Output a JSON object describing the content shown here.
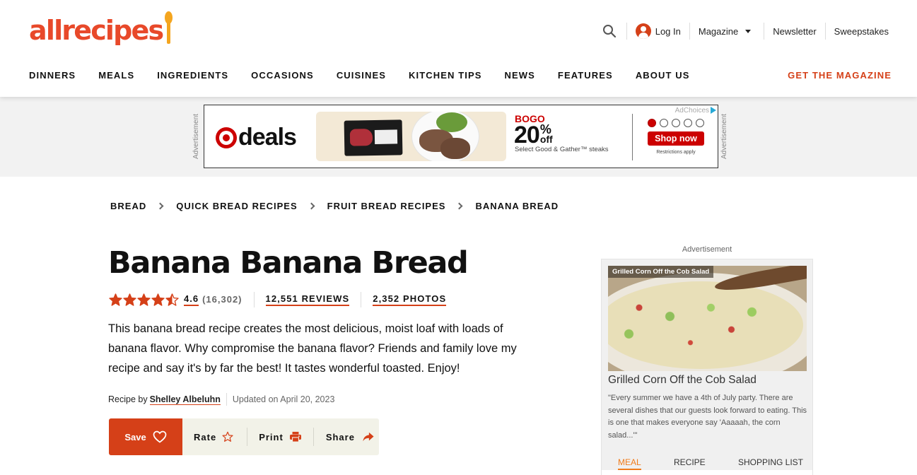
{
  "brand": {
    "logo_text": "allrecipes",
    "accent_color": "#d54018",
    "logo_color": "#e8492a",
    "spoon_color": "#f4a51f"
  },
  "utility_nav": {
    "search_icon": "search-icon",
    "login_label": "Log In",
    "magazine_label": "Magazine",
    "newsletter_label": "Newsletter",
    "sweepstakes_label": "Sweepstakes"
  },
  "main_nav": {
    "items": [
      {
        "label": "DINNERS"
      },
      {
        "label": "MEALS"
      },
      {
        "label": "INGREDIENTS"
      },
      {
        "label": "OCCASIONS"
      },
      {
        "label": "CUISINES"
      },
      {
        "label": "KITCHEN TIPS"
      },
      {
        "label": "NEWS"
      },
      {
        "label": "FEATURES"
      },
      {
        "label": "ABOUT US"
      }
    ],
    "cta_label": "GET THE MAGAZINE"
  },
  "top_ad": {
    "side_label": "Advertisement",
    "brand_text": "deals",
    "headline": "BOGO",
    "percent": "20",
    "percent_sign": "%",
    "off_label": "off",
    "subtext": "Select Good & Gather™ steaks",
    "adchoices_label": "AdChoices",
    "cta_label": "Shop now",
    "restrictions": "Restrictions apply",
    "carousel_total": 5,
    "carousel_active": 1
  },
  "breadcrumb": [
    {
      "label": "BREAD"
    },
    {
      "label": "QUICK BREAD RECIPES"
    },
    {
      "label": "FRUIT BREAD RECIPES"
    },
    {
      "label": "BANANA BREAD"
    }
  ],
  "recipe": {
    "title": "Banana Banana Bread",
    "rating": "4.6",
    "rating_value": 4.6,
    "rating_max": 5,
    "rating_count": "(16,302)",
    "reviews_label": "12,551 REVIEWS",
    "photos_label": "2,352 PHOTOS",
    "description": "This banana bread recipe creates the most delicious, moist loaf with loads of banana flavor. Why compromise the banana flavor? Friends and family love my recipe and say it's by far the best! It tastes wonderful toasted. Enjoy!",
    "byline_prefix": "Recipe by",
    "author": "Shelley Albeluhn",
    "updated": "Updated on April 20, 2023"
  },
  "actions": {
    "save_label": "Save",
    "rate_label": "Rate",
    "print_label": "Print",
    "share_label": "Share"
  },
  "sidebar_ad": {
    "label": "Advertisement",
    "image_caption": "Grilled Corn Off the Cob Salad",
    "title": "Grilled Corn Off the Cob Salad",
    "description": "\"Every summer we have a 4th of July party. There are several dishes that our guests look forward to eating. This is one that makes everyone say 'Aaaaah, the corn salad...'\"",
    "tabs": [
      {
        "label": "MEAL",
        "active": true
      },
      {
        "label": "RECIPE",
        "active": false
      },
      {
        "label": "SHOPPING LIST",
        "active": false
      }
    ],
    "tab_active_color": "#f07b1b"
  }
}
